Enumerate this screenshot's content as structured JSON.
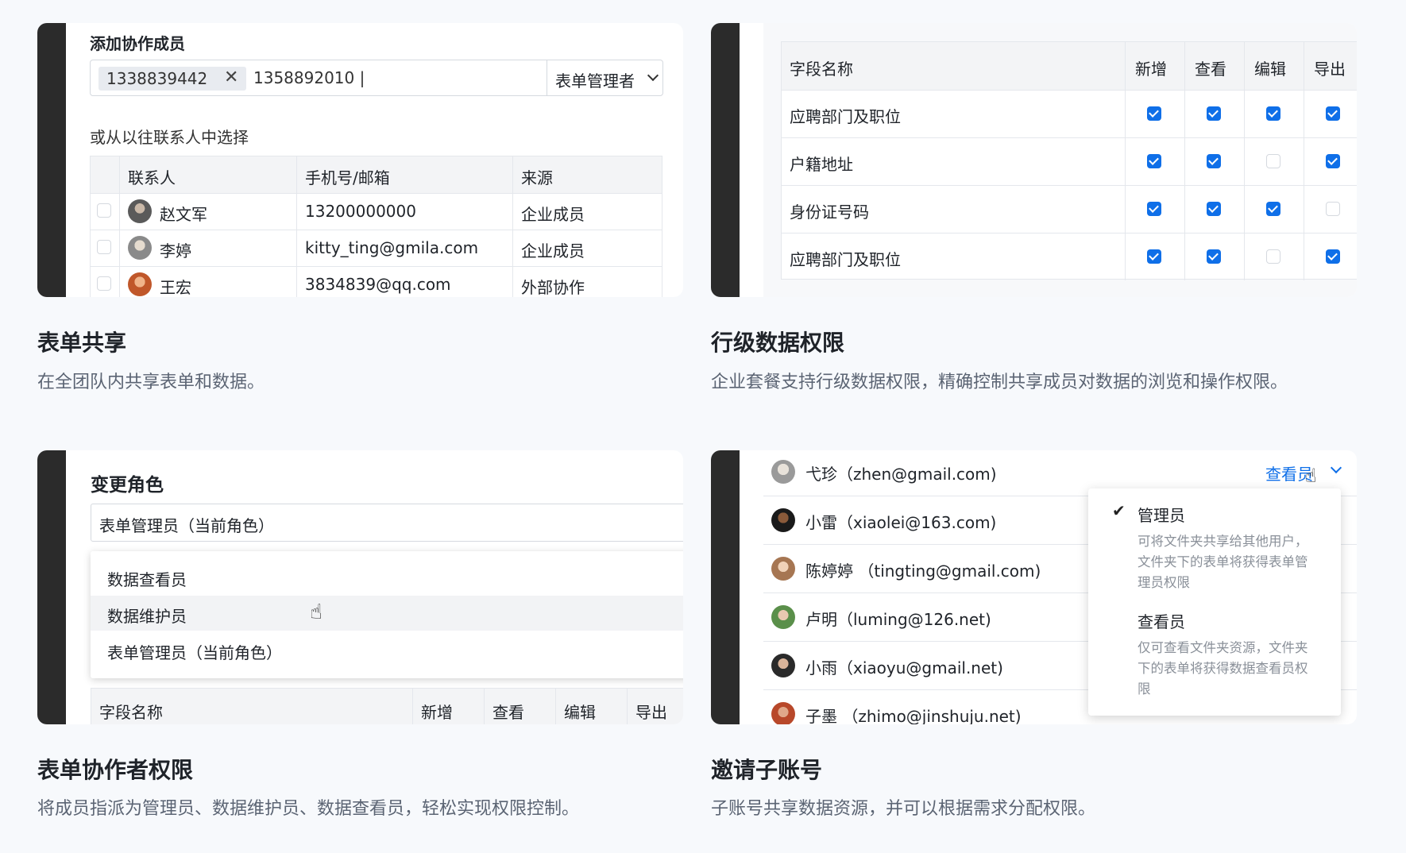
{
  "panel1": {
    "heading": "添加协作成员",
    "tag_value": "1338839442",
    "typed_value": "1358892010 |",
    "role_select": "表单管理者",
    "subheading": "或从以往联系人中选择",
    "columns": [
      "联系人",
      "手机号/邮箱",
      "来源"
    ],
    "rows": [
      {
        "name": "赵文军",
        "contact": "13200000000",
        "source": "企业成员"
      },
      {
        "name": "李婷",
        "contact": "kitty_ting@gmila.com",
        "source": "企业成员"
      },
      {
        "name": "王宏",
        "contact": "3834839@qq.com",
        "source": "外部协作"
      }
    ],
    "title": "表单共享",
    "desc": "在全团队内共享表单和数据。"
  },
  "panel2": {
    "columns": [
      "字段名称",
      "新增",
      "查看",
      "编辑",
      "导出"
    ],
    "rows": [
      {
        "name": "应聘部门及职位",
        "checks": [
          true,
          true,
          true,
          true
        ]
      },
      {
        "name": "户籍地址",
        "checks": [
          true,
          true,
          false,
          true
        ]
      },
      {
        "name": "身份证号码",
        "checks": [
          true,
          true,
          true,
          false
        ]
      },
      {
        "name": "应聘部门及职位",
        "checks": [
          true,
          true,
          false,
          true
        ]
      }
    ],
    "title": "行级数据权限",
    "desc": "企业套餐支持行级数据权限，精确控制共享成员对数据的浏览和操作权限。"
  },
  "panel3": {
    "heading": "变更角色",
    "current_value": "表单管理员（当前角色）",
    "options": [
      "数据查看员",
      "数据维护员",
      "表单管理员（当前角色）"
    ],
    "columns": [
      "字段名称",
      "新增",
      "查看",
      "编辑",
      "导出"
    ],
    "title": "表单协作者权限",
    "desc": "将成员指派为管理员、数据维护员、数据查看员，轻松实现权限控制。"
  },
  "panel4": {
    "members": [
      "弋珍（zhen@gmail.com)",
      "小雷（xiaolei@163.com)",
      "陈婷婷 （tingting@gmail.com)",
      "卢明（luming@126.net)",
      "小雨（xiaoyu@gmail.net)",
      "子墨 （zhimo@jinshuju.net)"
    ],
    "role_dropdown": "查看员",
    "menu": [
      {
        "label": "管理员",
        "desc": "可将文件夹共享给其他用户，文件夹下的表单将获得表单管理员权限",
        "checked": true
      },
      {
        "label": "查看员",
        "desc": "仅可查看文件夹资源，文件夹下的表单将获得数据查看员权限",
        "checked": false
      }
    ],
    "title": "邀请子账号",
    "desc": "子账号共享数据资源，并可以根据需求分配权限。"
  },
  "colors": {
    "accent": "#0f6fe8",
    "dark_bar": "#2b2b2b",
    "page_bg": "#f7f9fc"
  }
}
